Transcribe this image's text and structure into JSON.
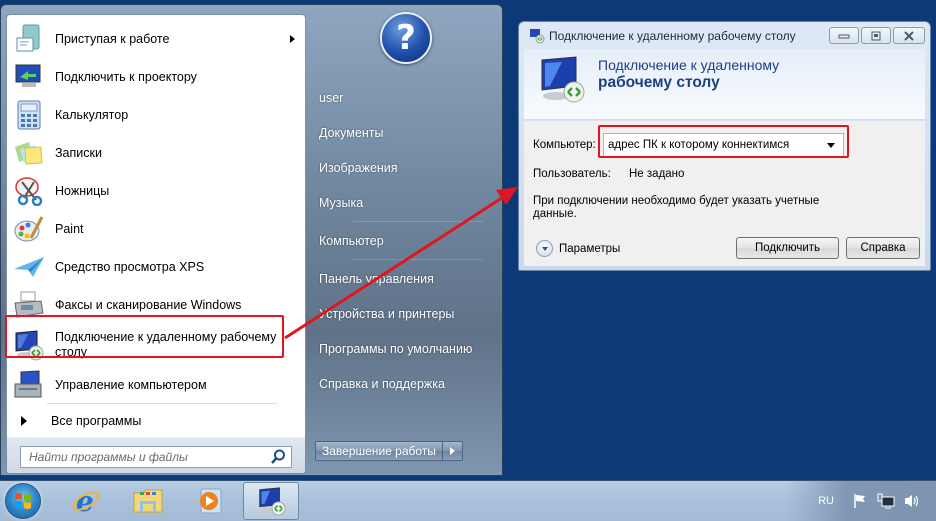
{
  "start_menu": {
    "programs": [
      {
        "label": "Приступая к работе",
        "icon": "getting-started-icon",
        "has_submenu": true
      },
      {
        "label": "Подключить к проектору",
        "icon": "projector-icon",
        "has_submenu": false
      },
      {
        "label": "Калькулятор",
        "icon": "calculator-icon",
        "has_submenu": false
      },
      {
        "label": "Записки",
        "icon": "sticky-notes-icon",
        "has_submenu": false
      },
      {
        "label": "Ножницы",
        "icon": "scissors-icon",
        "has_submenu": false
      },
      {
        "label": "Paint",
        "icon": "paint-palette-icon",
        "has_submenu": false
      },
      {
        "label": "Средство просмотра XPS",
        "icon": "xps-viewer-icon",
        "has_submenu": false
      },
      {
        "label": "Факсы и сканирование Windows",
        "icon": "fax-scanner-icon",
        "has_submenu": false
      },
      {
        "label": "Подключение к удаленному рабочему столу",
        "icon": "remote-desktop-icon",
        "has_submenu": false
      },
      {
        "label": "Управление компьютером",
        "icon": "computer-management-icon",
        "has_submenu": false
      }
    ],
    "all_programs_label": "Все программы",
    "search_placeholder": "Найти программы и файлы",
    "user_picture_glyph": "?",
    "places": [
      "user",
      "Документы",
      "Изображения",
      "Музыка",
      "Компьютер",
      "Панель управления",
      "Устройства и принтеры",
      "Программы по умолчанию",
      "Справка и поддержка"
    ],
    "shutdown_label": "Завершение работы"
  },
  "rdp_dialog": {
    "title": "Подключение к удаленному рабочему столу",
    "heading_line1": "Подключение к удаленному",
    "heading_line2": "рабочему столу",
    "computer_label": "Компьютер:",
    "computer_value": "адрес ПК к которому коннектимся",
    "user_label": "Пользователь:",
    "user_value": "Не задано",
    "info_text": "При подключении необходимо будет указать учетные данные.",
    "options_label": "Параметры",
    "connect_label": "Подключить",
    "help_label": "Справка"
  },
  "taskbar": {
    "items": [
      "start-orb",
      "internet-explorer",
      "windows-explorer",
      "windows-media-player",
      "remote-desktop-connection"
    ],
    "language": "RU",
    "tray_icons": [
      "action-center-flag-icon",
      "network-icon",
      "volume-icon"
    ]
  },
  "colors": {
    "desktop": "#0c3a78",
    "highlight": "#e0151f",
    "heading_text": "#1e3f86"
  }
}
